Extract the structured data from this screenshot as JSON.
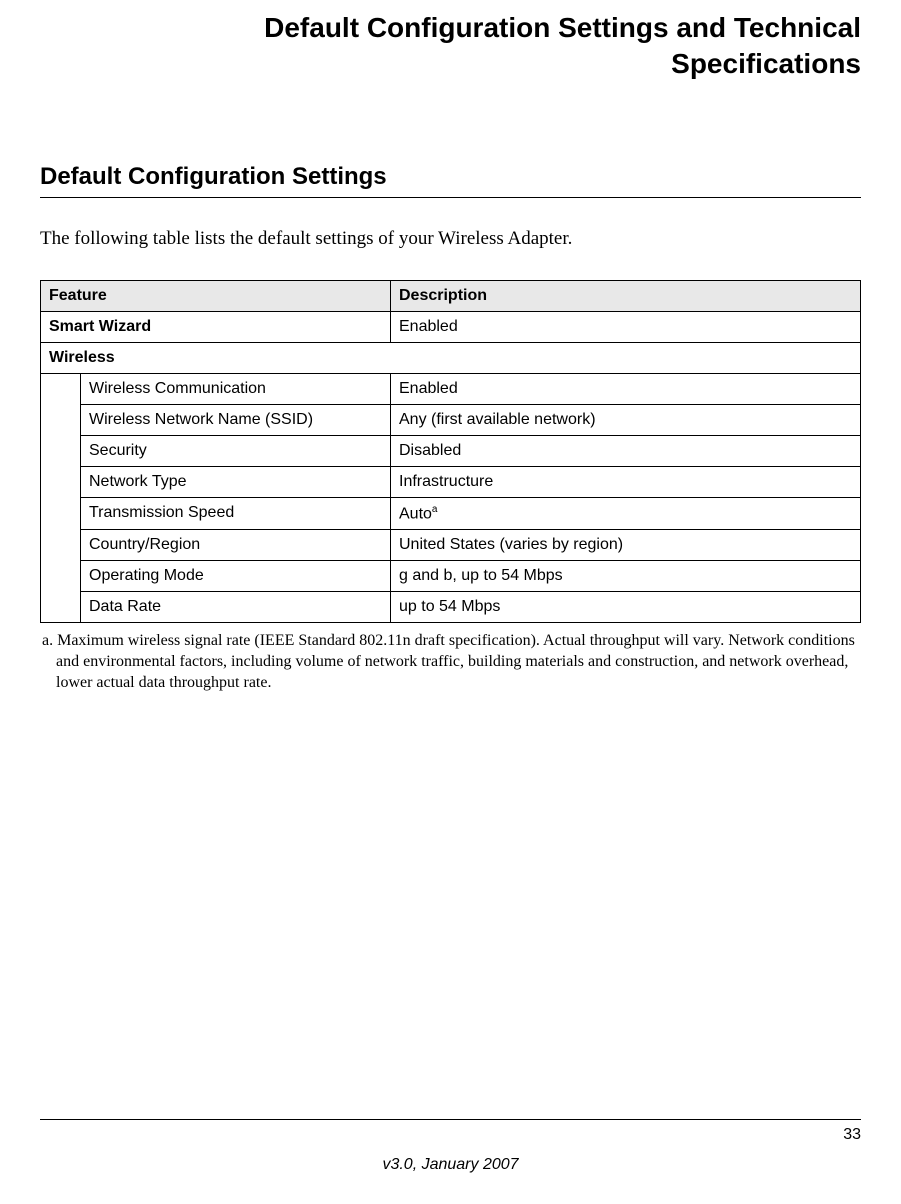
{
  "title_line1": "Default Configuration Settings and Technical",
  "title_line2": "Specifications",
  "section_heading": "Default Configuration Settings",
  "intro": "The following table lists the default settings of your Wireless Adapter.",
  "table": {
    "header_feature": "Feature",
    "header_description": "Description",
    "smart_wizard_label": "Smart Wizard",
    "smart_wizard_value": "Enabled",
    "wireless_label": "Wireless",
    "rows": [
      {
        "feature": "Wireless Communication",
        "value": "Enabled"
      },
      {
        "feature": "Wireless Network Name (SSID)",
        "value": "Any (first available network)"
      },
      {
        "feature": "Security",
        "value": "Disabled"
      },
      {
        "feature": "Network Type",
        "value": "Infrastructure"
      },
      {
        "feature": "Transmission Speed",
        "value": "Auto",
        "sup": "a"
      },
      {
        "feature": "Country/Region",
        "value": "United States (varies by region)"
      },
      {
        "feature": "Operating Mode",
        "value": "g and b, up to 54 Mbps"
      },
      {
        "feature": "Data Rate",
        "value": "up to 54 Mbps"
      }
    ]
  },
  "footnote": "a. Maximum wireless signal rate (IEEE Standard 802.11n draft specification). Actual throughput will vary. Network conditions and environmental factors, including volume of network traffic, building materials and construction, and network overhead, lower actual data throughput rate.",
  "page_number": "33",
  "footer_version": "v3.0, January 2007"
}
